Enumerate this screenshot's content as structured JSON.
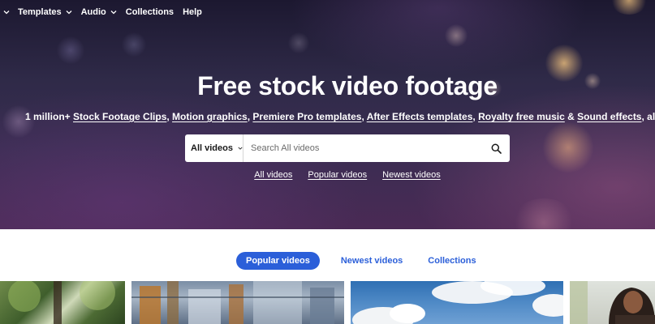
{
  "nav": {
    "items": [
      {
        "label": "Templates",
        "dropdown": true
      },
      {
        "label": "Audio",
        "dropdown": true
      },
      {
        "label": "Collections",
        "dropdown": false
      },
      {
        "label": "Help",
        "dropdown": false
      }
    ]
  },
  "hero": {
    "title": "Free stock video footage",
    "subtitle": {
      "prefix": "1 million+ ",
      "links": [
        "Stock Footage Clips",
        "Motion graphics",
        "Premiere Pro templates",
        "After Effects templates",
        "Royalty free music",
        "Sound effects"
      ],
      "sep": ", ",
      "amp": " & ",
      "suffix": ", all at your fingert"
    }
  },
  "search": {
    "category": "All videos",
    "placeholder": "Search All videos"
  },
  "quicklinks": [
    "All videos",
    "Popular videos",
    "Newest videos"
  ],
  "tabs": [
    {
      "label": "Popular videos",
      "active": true
    },
    {
      "label": "Newest videos",
      "active": false
    },
    {
      "label": "Collections",
      "active": false
    }
  ],
  "colors": {
    "accent": "#2b5fd9",
    "hero_dark": "#2f2a48"
  }
}
